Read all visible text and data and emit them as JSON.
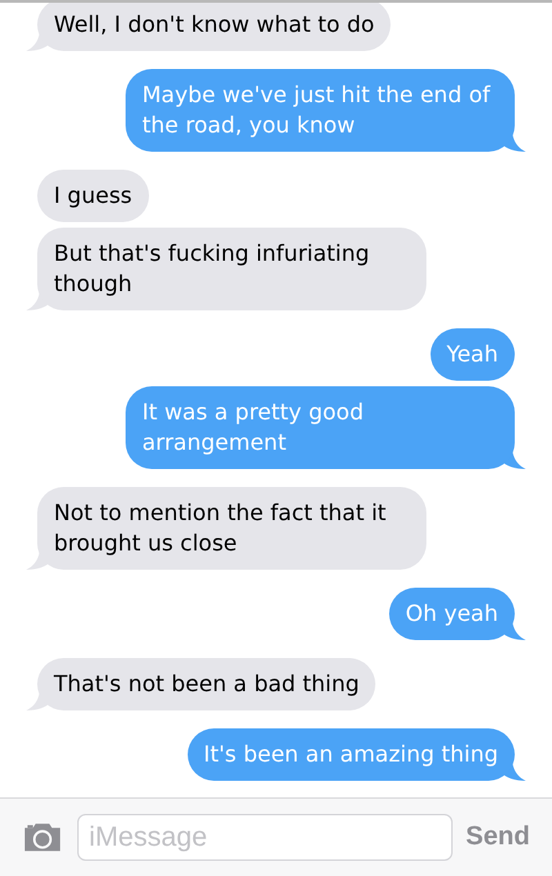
{
  "messages": [
    {
      "kind": "received",
      "text": "Well, I don't know what to do",
      "tail": true
    },
    {
      "kind": "sent",
      "text": "Maybe we've just hit the end of the road, you know",
      "tail": true
    },
    {
      "kind": "received",
      "text": "I guess",
      "tail": false
    },
    {
      "kind": "received",
      "text": "But that's fucking infuriating though",
      "tail": true
    },
    {
      "kind": "sent",
      "text": "Yeah",
      "tail": false
    },
    {
      "kind": "sent",
      "text": "It was a pretty good arrangement",
      "tail": true
    },
    {
      "kind": "received",
      "text": "Not to mention the fact that it brought us close",
      "tail": true
    },
    {
      "kind": "sent",
      "text": "Oh yeah",
      "tail": true
    },
    {
      "kind": "received",
      "text": "That's not been a bad thing",
      "tail": true
    },
    {
      "kind": "sent",
      "text": "It's been an amazing thing",
      "tail": true
    }
  ],
  "composer": {
    "placeholder": "iMessage",
    "send": "Send"
  }
}
